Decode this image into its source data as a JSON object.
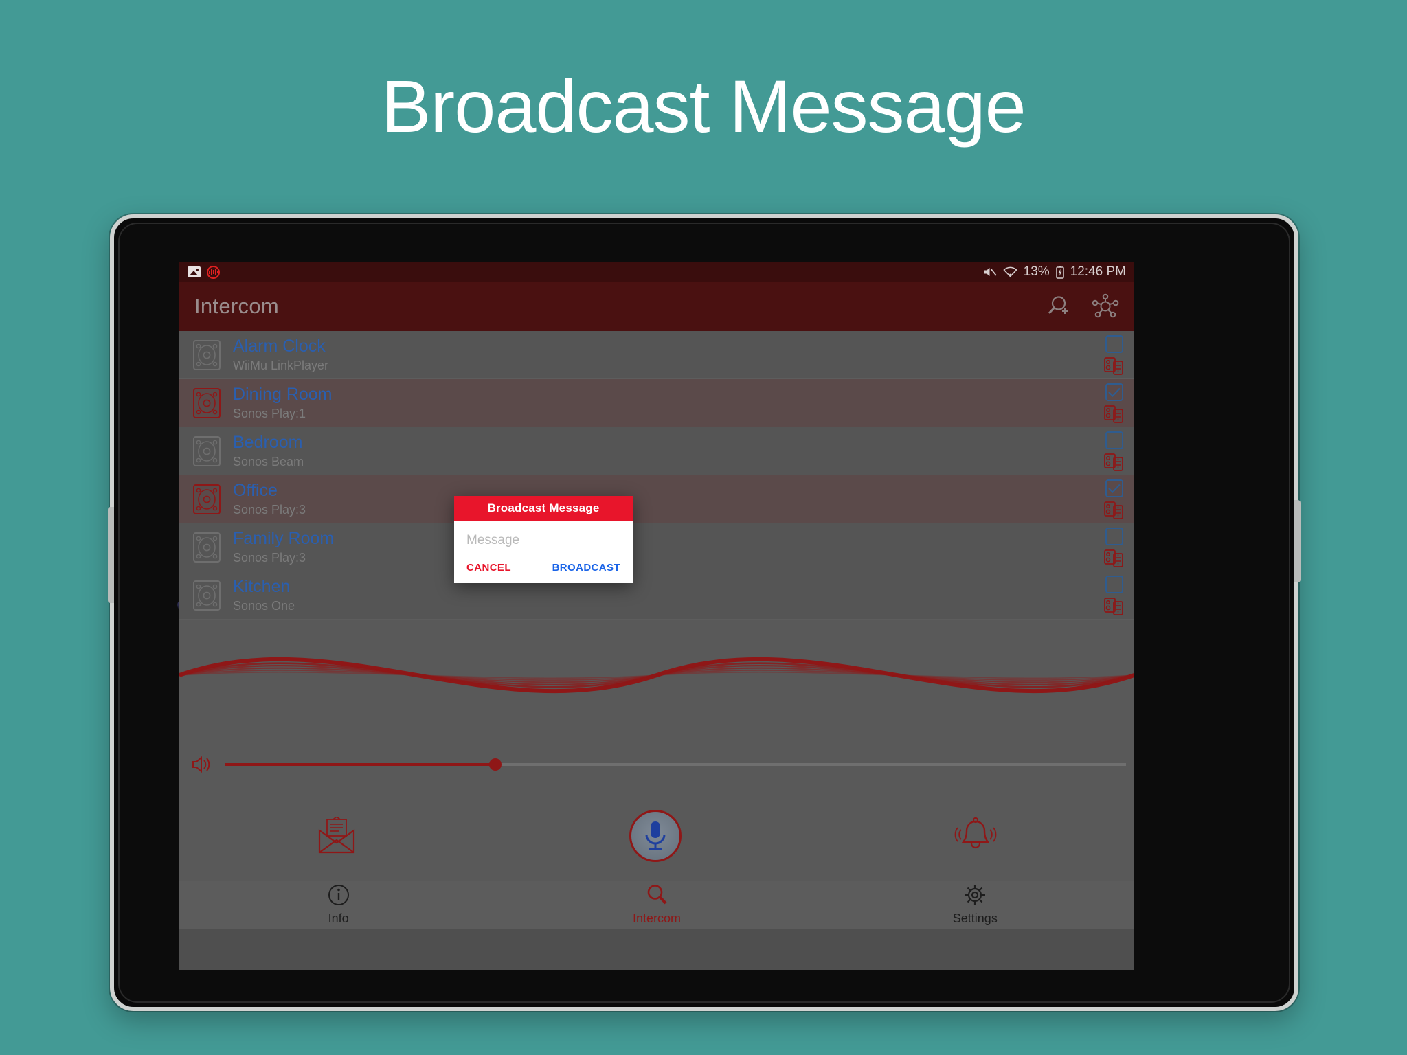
{
  "page": {
    "title": "Broadcast Message",
    "background_color": "#439a95"
  },
  "device_frame": {
    "type": "tablet",
    "bezel_color": "#cfd2d0",
    "screen_color": "#0a0a0a"
  },
  "statusbar": {
    "notif_icons": [
      "screenshot-icon",
      "audio-recording-icon"
    ],
    "mute_icon": "volume-mute-icon",
    "wifi_icon": "wifi-icon",
    "battery_percent": "13%",
    "battery_icon": "battery-charging-icon",
    "time": "12:46 PM",
    "background_color": "#3a0d0d"
  },
  "appbar": {
    "title": "Intercom",
    "background_color": "#4a1111",
    "actions": [
      {
        "name": "search-add-icon",
        "label": "Add device"
      },
      {
        "name": "network-hub-icon",
        "label": "Network"
      }
    ]
  },
  "devices": {
    "columns": [
      "name",
      "model",
      "selected"
    ],
    "items": [
      {
        "name": "Alarm Clock",
        "model": "WiiMu LinkPlayer",
        "selected": false
      },
      {
        "name": "Dining Room",
        "model": "Sonos Play:1",
        "selected": true
      },
      {
        "name": "Bedroom",
        "model": "Sonos Beam",
        "selected": false
      },
      {
        "name": "Office",
        "model": "Sonos Play:3",
        "selected": true
      },
      {
        "name": "Family Room",
        "model": "Sonos Play:3",
        "selected": false
      },
      {
        "name": "Kitchen",
        "model": "Sonos One",
        "selected": false
      }
    ],
    "selected_color": "#8f1717",
    "unselected_color": "#6e6e6e",
    "name_color": "#2a5fb0"
  },
  "waveform": {
    "color": "#8f1717",
    "description": "audio sine waveform visualizer"
  },
  "volume": {
    "icon": "volume-up-icon",
    "value_percent": 30,
    "fill_color": "#8f1717"
  },
  "actions": {
    "message_icon": "envelope-message-icon",
    "mic_icon": "microphone-icon",
    "bell_icon": "bell-alert-icon"
  },
  "bottom_nav": {
    "items": [
      {
        "label": "Info",
        "icon": "info-circle-icon",
        "active": false
      },
      {
        "label": "Intercom",
        "icon": "search-icon",
        "active": true
      },
      {
        "label": "Settings",
        "icon": "gear-icon",
        "active": false
      }
    ],
    "active_color": "#8f1717"
  },
  "dialog": {
    "title": "Broadcast Message",
    "header_color": "#e8152b",
    "input_value": "",
    "input_placeholder": "Message",
    "cancel_label": "CANCEL",
    "cancel_color": "#e8152b",
    "broadcast_label": "BROADCAST",
    "broadcast_color": "#1a64e8"
  },
  "chart_data": {
    "type": "line",
    "title": "",
    "xlabel": "",
    "ylabel": "",
    "series": [
      {
        "name": "wave-1",
        "amplitude": 1.0
      },
      {
        "name": "wave-2",
        "amplitude": 0.72
      },
      {
        "name": "wave-3",
        "amplitude": 0.55
      },
      {
        "name": "wave-4",
        "amplitude": 0.38
      },
      {
        "name": "wave-5",
        "amplitude": 0.22
      },
      {
        "name": "wave-6",
        "amplitude": 0.1
      }
    ]
  }
}
